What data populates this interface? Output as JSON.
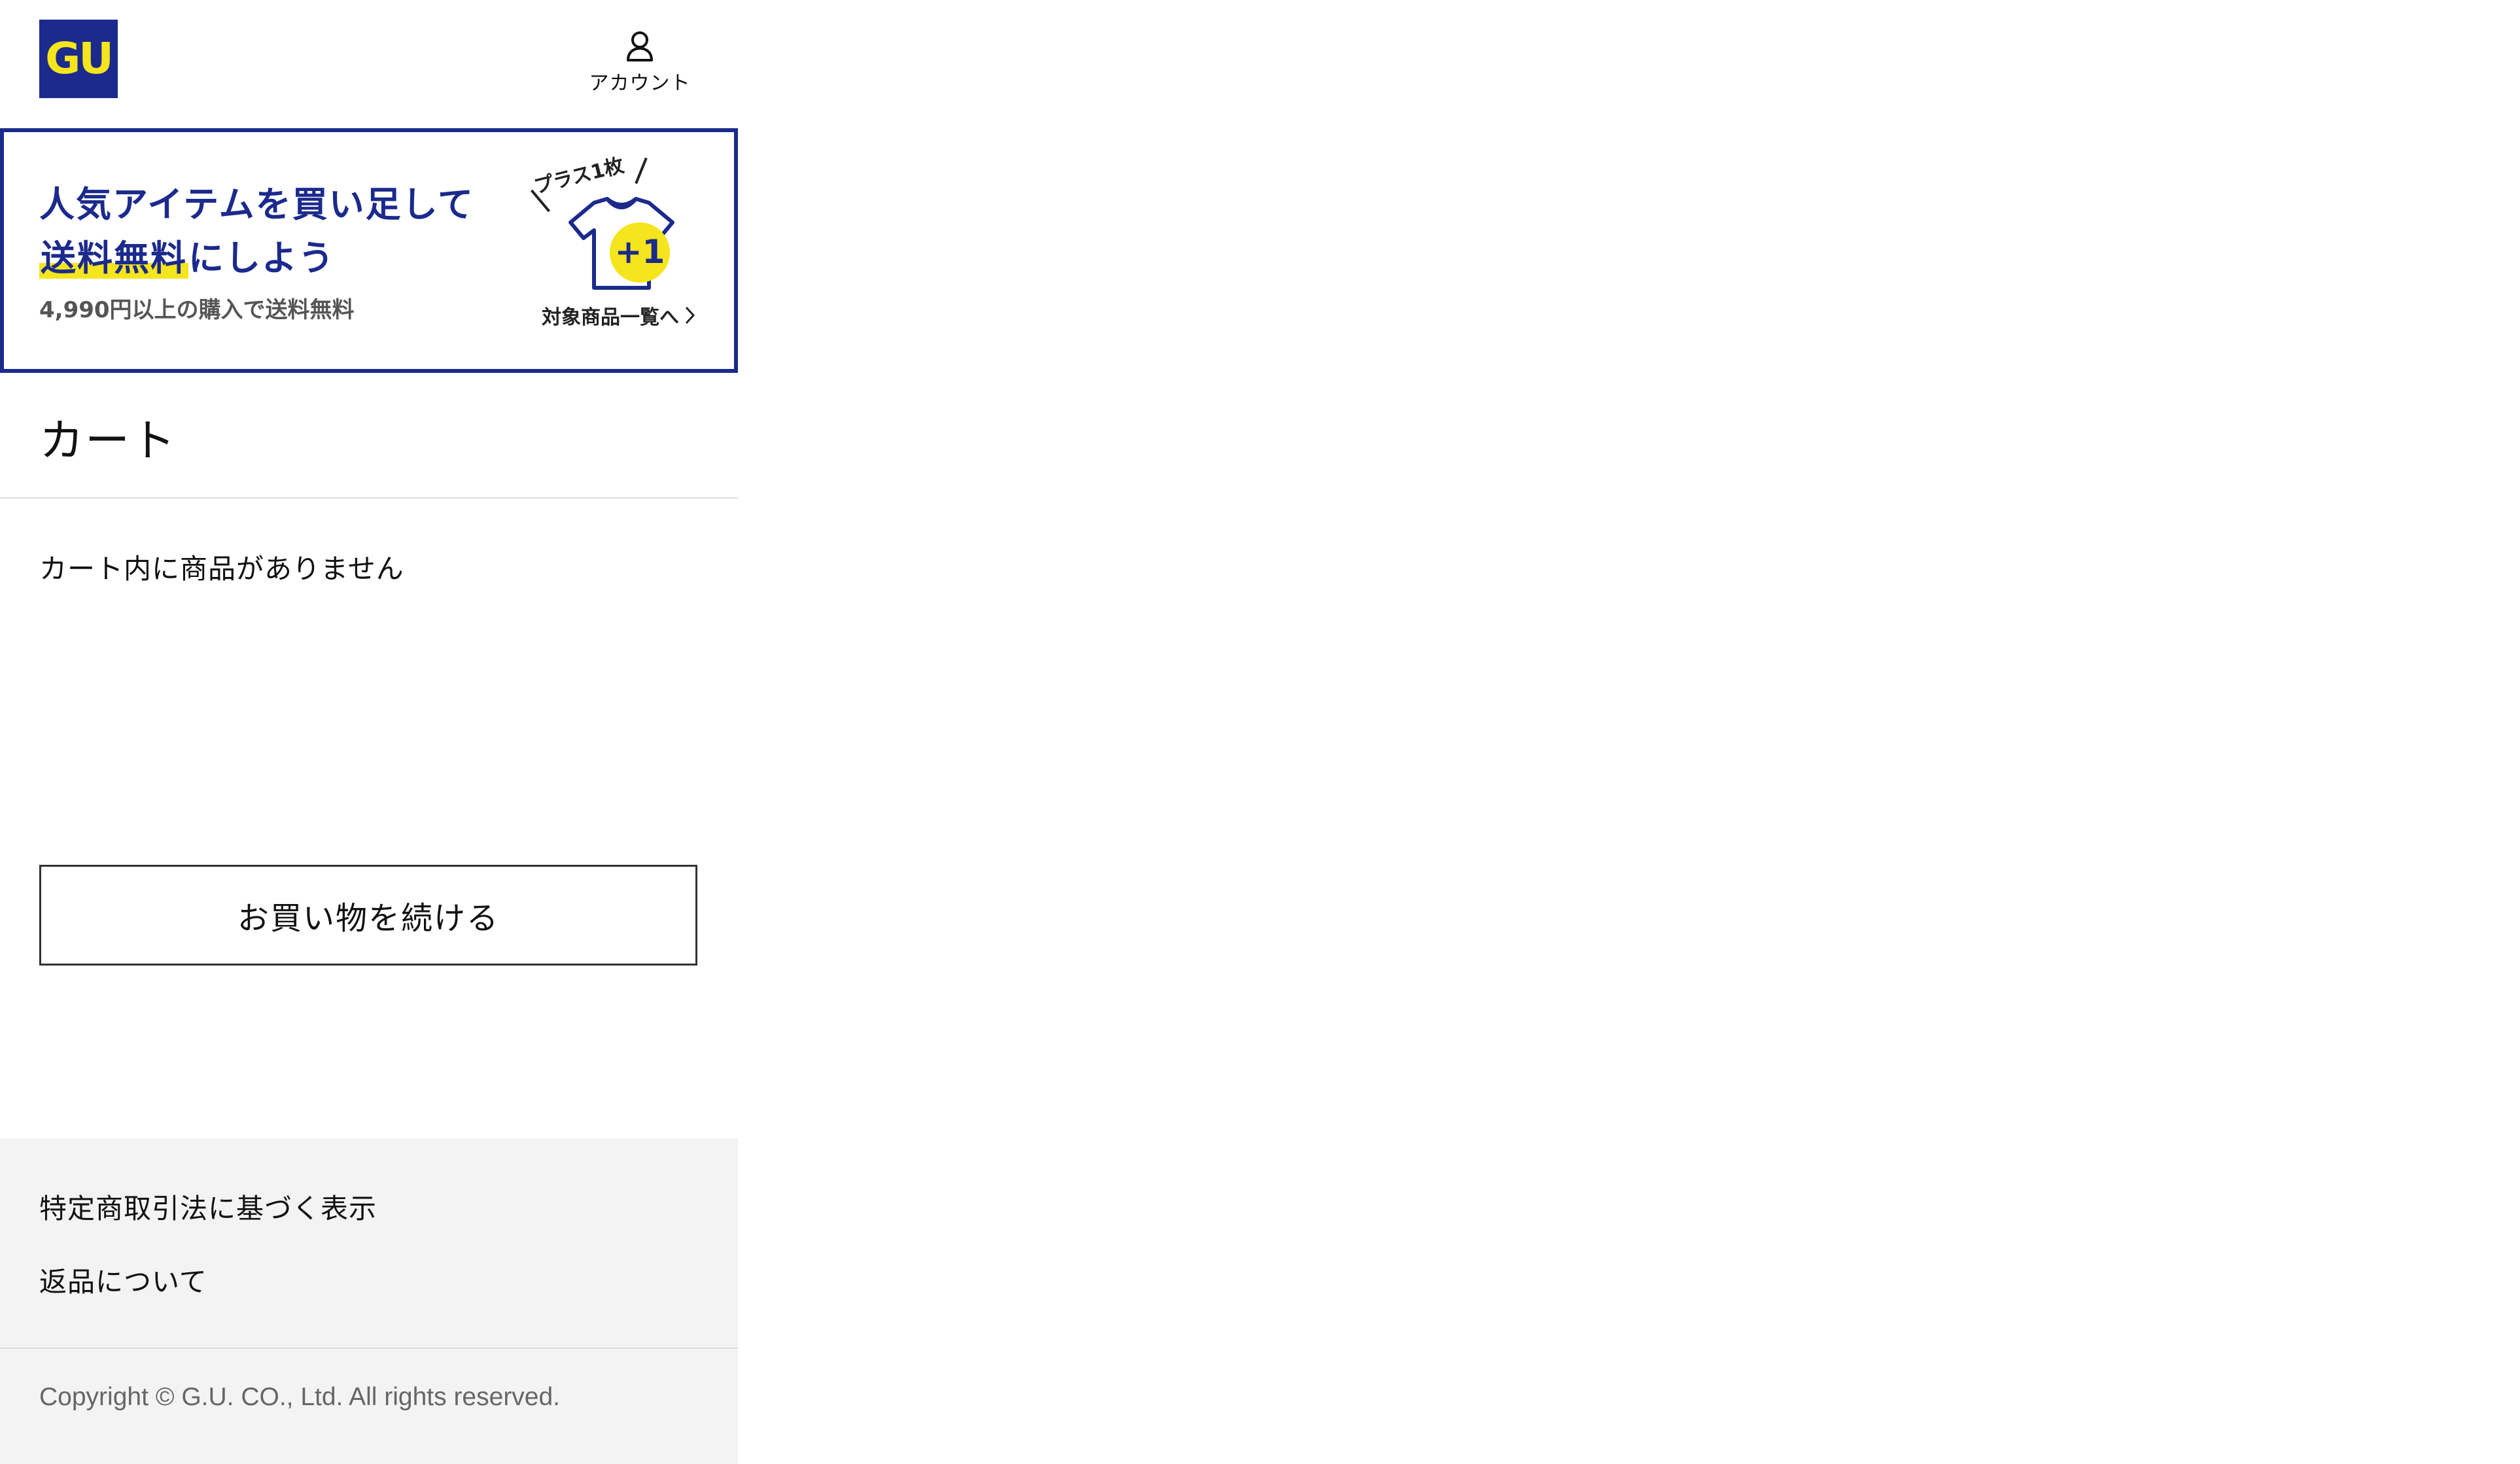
{
  "header": {
    "logo_text": "GU",
    "account_label": "アカウント",
    "account_icon": "user-icon"
  },
  "banner": {
    "headline_line1": "人気アイテムを買い足して",
    "headline_highlight": "送料無料",
    "headline_line2_rest": "にしよう",
    "subtext": "4,990円以上の購入で送料無料",
    "tag": "プラス1枚",
    "badge": "+1",
    "link_label": "対象商品一覧へ",
    "link_icon": "chevron-right-icon"
  },
  "page": {
    "title": "カート",
    "empty_message": "カート内に商品がありません",
    "continue_button": "お買い物を続ける"
  },
  "footer": {
    "links": [
      "特定商取引法に基づく表示",
      "返品について"
    ],
    "copyright": "Copyright © G.U. CO., Ltd. All rights reserved."
  },
  "colors": {
    "brand_navy": "#1b2a8c",
    "brand_yellow": "#f4e51c",
    "footer_bg": "#f3f3f3"
  }
}
